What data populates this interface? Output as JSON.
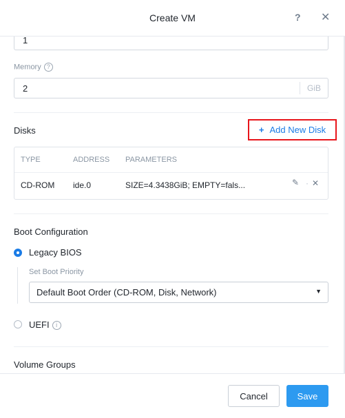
{
  "dialog": {
    "title": "Create VM",
    "help_label": "?",
    "close_label": "✕"
  },
  "fields": {
    "top_value": "1",
    "memory": {
      "label": "Memory",
      "info": "?",
      "value": "2",
      "unit": "GiB"
    }
  },
  "disks": {
    "title": "Disks",
    "add_plus": "+",
    "add_label": "Add New Disk",
    "columns": {
      "type": "TYPE",
      "address": "ADDRESS",
      "parameters": "PARAMETERS"
    },
    "rows": [
      {
        "type": "CD-ROM",
        "address": "ide.0",
        "parameters": "SIZE=4.3438GiB; EMPTY=fals..."
      }
    ],
    "edit_icon": "✎",
    "sep": "·",
    "delete_icon": "✕"
  },
  "boot": {
    "title": "Boot Configuration",
    "legacy_label": "Legacy BIOS",
    "priority_label": "Set Boot Priority",
    "priority_value": "Default Boot Order (CD-ROM, Disk, Network)",
    "uefi_label": "UEFI",
    "uefi_info": "i",
    "selected": "Legacy BIOS"
  },
  "volume_groups": {
    "title": "Volume Groups"
  },
  "footer": {
    "cancel_label": "Cancel",
    "save_label": "Save"
  },
  "colors": {
    "accent": "#1b7ce6",
    "save_bg": "#2d9af0",
    "highlight": "#e8141a"
  }
}
